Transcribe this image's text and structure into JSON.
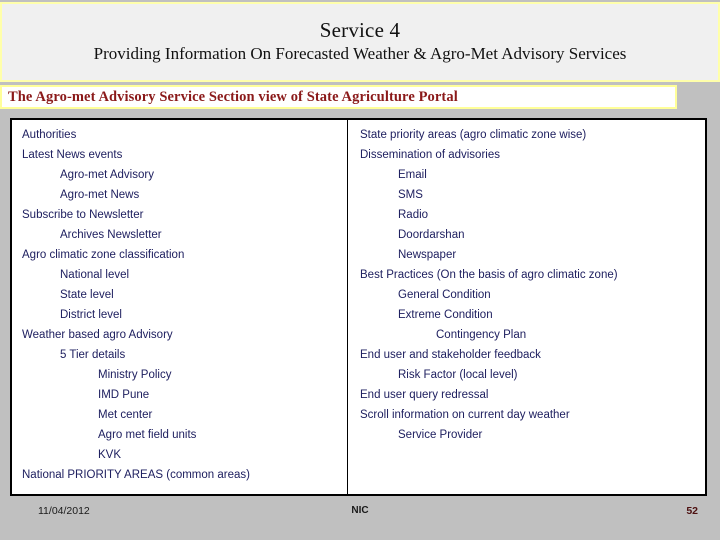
{
  "title": {
    "main": "Service 4",
    "sub": "Providing Information On Forecasted Weather & Agro-Met Advisory Services"
  },
  "banner": {
    "text": "The Agro-met Advisory Service Section view of State Agriculture Portal",
    "border_color": "#ffff99",
    "text_color": "#8b1a1a"
  },
  "content": {
    "text_color": "#1f2060",
    "left_column": [
      {
        "label": "Authorities",
        "indent": 0
      },
      {
        "label": "Latest News events",
        "indent": 0
      },
      {
        "label": "Agro-met Advisory",
        "indent": 1
      },
      {
        "label": "Agro-met News",
        "indent": 1
      },
      {
        "label": "Subscribe to Newsletter",
        "indent": 0
      },
      {
        "label": "Archives Newsletter",
        "indent": 1
      },
      {
        "label": "Agro climatic zone classification",
        "indent": 0
      },
      {
        "label": "National level",
        "indent": 1
      },
      {
        "label": "State level",
        "indent": 1
      },
      {
        "label": "District level",
        "indent": 1
      },
      {
        "label": "Weather based agro Advisory",
        "indent": 0
      },
      {
        "label": "5 Tier details",
        "indent": 1
      },
      {
        "label": "Ministry Policy",
        "indent": 2
      },
      {
        "label": "IMD Pune",
        "indent": 2
      },
      {
        "label": "Met center",
        "indent": 2
      },
      {
        "label": "Agro met field units",
        "indent": 2
      },
      {
        "label": "KVK",
        "indent": 2
      },
      {
        "label": "National PRIORITY AREAS (common areas)",
        "indent": 0
      }
    ],
    "right_column": [
      {
        "label": "State priority areas (agro climatic zone wise)",
        "indent": 0
      },
      {
        "label": "Dissemination of advisories",
        "indent": 0
      },
      {
        "label": "Email",
        "indent": 1
      },
      {
        "label": "SMS",
        "indent": 1
      },
      {
        "label": "Radio",
        "indent": 1
      },
      {
        "label": "Doordarshan",
        "indent": 1
      },
      {
        "label": "Newspaper",
        "indent": 1
      },
      {
        "label": "Best Practices (On the basis of agro climatic zone)",
        "indent": 0
      },
      {
        "label": "General Condition",
        "indent": 1
      },
      {
        "label": "Extreme Condition",
        "indent": 1
      },
      {
        "label": "Contingency Plan",
        "indent": 2
      },
      {
        "label": "End user and stakeholder feedback",
        "indent": 0
      },
      {
        "label": "Risk Factor (local level)",
        "indent": 1
      },
      {
        "label": "End user query redressal",
        "indent": 0
      },
      {
        "label": "Scroll information on current day weather",
        "indent": 0
      },
      {
        "label": "Service Provider",
        "indent": 1
      }
    ]
  },
  "footer": {
    "date": "11/04/2012",
    "center": "NIC",
    "page": "52"
  }
}
